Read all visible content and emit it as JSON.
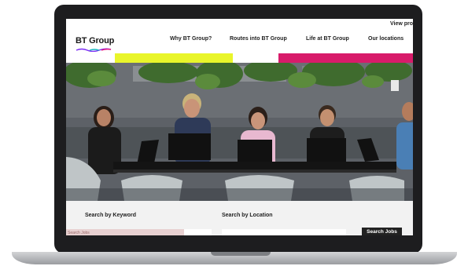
{
  "header": {
    "top_link": "View pro",
    "logo_text": "BT Group"
  },
  "nav": {
    "items": [
      {
        "label": "Why BT Group?"
      },
      {
        "label": "Routes into BT Group"
      },
      {
        "label": "Life at BT Group"
      },
      {
        "label": "Our locations"
      }
    ]
  },
  "band_colors": {
    "pink": "#ef6bd6",
    "yellow": "#e9f52b",
    "teal": "#39bcb8",
    "magenta": "#d81b6a"
  },
  "search": {
    "keyword_label": "Search by Keyword",
    "keyword_placeholder": "Search Jobs",
    "location_label": "Search by Location",
    "button_label": "Search Jobs"
  }
}
